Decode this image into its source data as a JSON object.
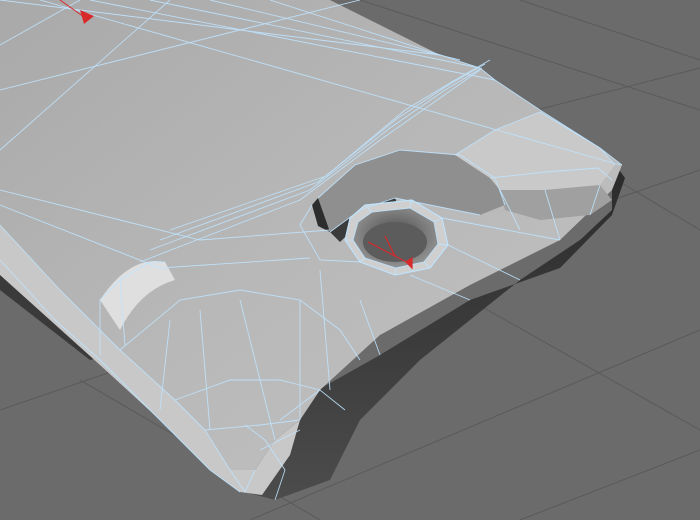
{
  "viewport": {
    "view": "perspective",
    "background_color": "#6b6b6b",
    "grid_line_color": "#5a5a5a",
    "object": {
      "display_mode": "shaded-with-wireframe",
      "surface_color": "#b9b9b9",
      "wire_color": "#bfe4ff"
    },
    "gizmos": [
      {
        "type": "axis-pointer",
        "color": "#d8292b"
      },
      {
        "type": "pivot-axis",
        "color": "#d8292b"
      }
    ]
  }
}
